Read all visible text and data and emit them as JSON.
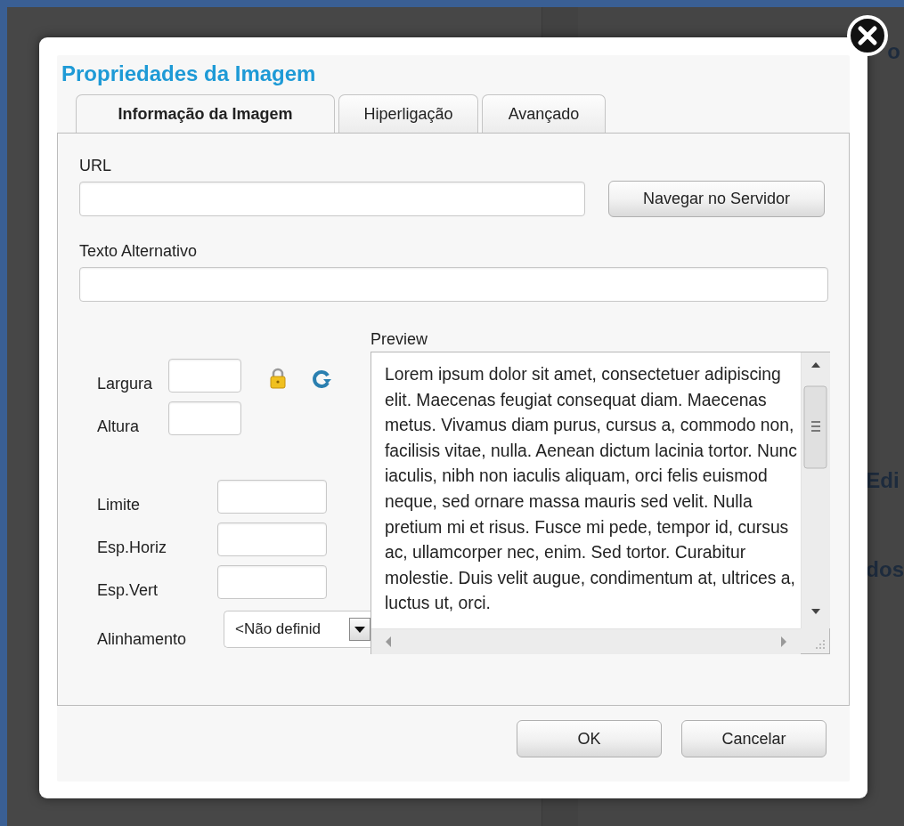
{
  "background": {
    "texts": [
      "o",
      "Edi",
      "dos"
    ]
  },
  "dialog": {
    "title": "Propriedades da Imagem",
    "tabs": [
      {
        "label": "Informação da Imagem",
        "selected": true
      },
      {
        "label": "Hiperligação",
        "selected": false
      },
      {
        "label": "Avançado",
        "selected": false
      }
    ],
    "url": {
      "label": "URL"
    },
    "browse_button": "Navegar no Servidor",
    "alt_text": {
      "label": "Texto Alternativo"
    },
    "size_fields": [
      {
        "label": "Largura"
      },
      {
        "label": "Altura"
      }
    ],
    "spacing_fields": [
      {
        "label": "Limite"
      },
      {
        "label": "Esp.Horiz"
      },
      {
        "label": "Esp.Vert"
      }
    ],
    "alignment": {
      "label": "Alinhamento",
      "value": "<Não definid"
    },
    "preview": {
      "label": "Preview",
      "text": "Lorem ipsum dolor sit amet, consectetuer adipiscing elit. Maecenas feugiat consequat diam. Maecenas metus. Vivamus diam purus, cursus a, commodo non, facilisis vitae, nulla. Aenean dictum lacinia tortor. Nunc iaculis, nibh non iaculis aliquam, orci felis euismod neque, sed ornare massa mauris sed velit. Nulla pretium mi et risus. Fusce mi pede, tempor id, cursus ac, ullamcorper nec, enim. Sed tortor. Curabitur molestie. Duis velit augue, condimentum at, ultrices a, luctus ut, orci."
    },
    "buttons": [
      "OK",
      "Cancelar"
    ]
  }
}
